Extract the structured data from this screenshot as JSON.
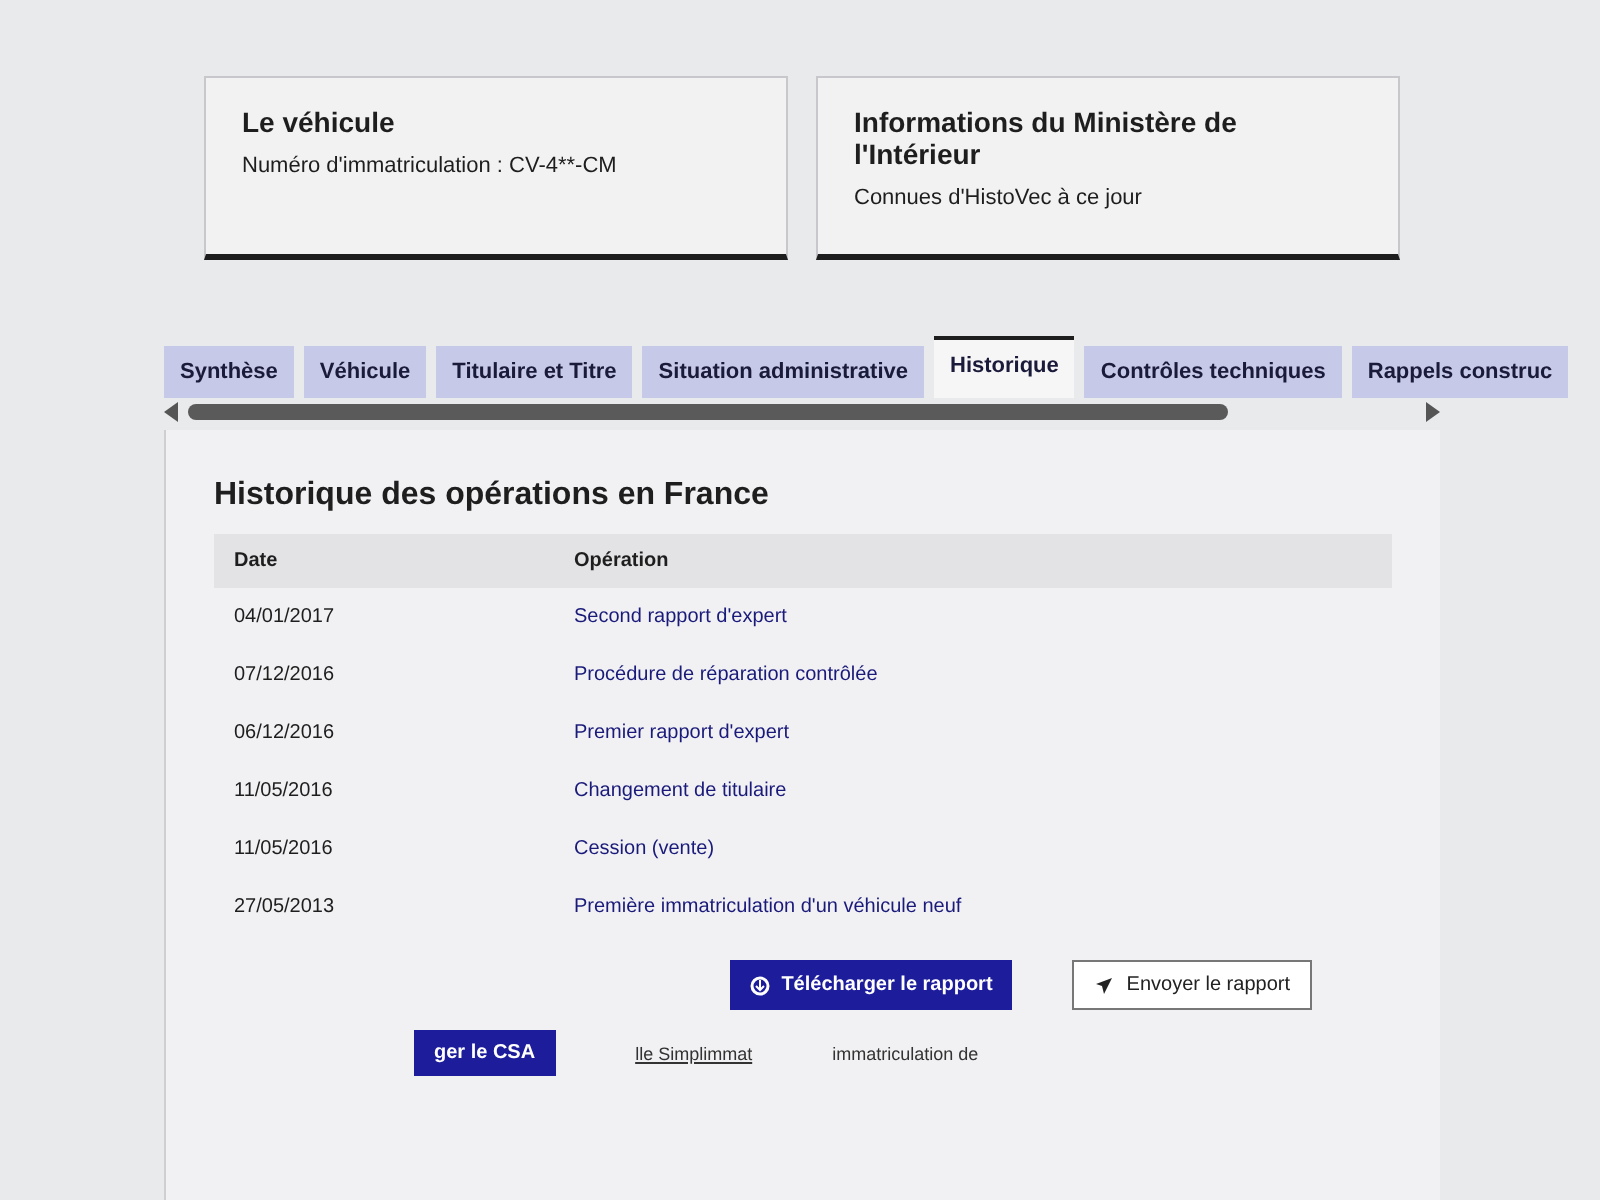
{
  "cards": [
    {
      "title": "Le véhicule",
      "subtitle": "Numéro d'immatriculation : CV-4**-CM"
    },
    {
      "title": "Informations du Ministère de l'Intérieur",
      "subtitle": "Connues d'HistoVec à ce jour"
    }
  ],
  "tabs": [
    {
      "label": "Synthèse",
      "selected": false
    },
    {
      "label": "Véhicule",
      "selected": false
    },
    {
      "label": "Titulaire et Titre",
      "selected": false
    },
    {
      "label": "Situation administrative",
      "selected": false
    },
    {
      "label": "Historique",
      "selected": true
    },
    {
      "label": "Contrôles techniques",
      "selected": false
    },
    {
      "label": "Rappels construc",
      "selected": false
    }
  ],
  "section": {
    "title": "Historique des opérations en France",
    "table": {
      "columns": [
        "Date",
        "Opération"
      ],
      "rows": [
        [
          "04/01/2017",
          "Second rapport d'expert"
        ],
        [
          "07/12/2016",
          "Procédure de réparation contrôlée"
        ],
        [
          "06/12/2016",
          "Premier rapport d'expert"
        ],
        [
          "11/05/2016",
          "Changement de titulaire"
        ],
        [
          "11/05/2016",
          "Cession (vente)"
        ],
        [
          "27/05/2013",
          "Première immatriculation d'un véhicule neuf"
        ]
      ]
    }
  },
  "actions": [
    {
      "label": "Télécharger le rapport",
      "kind": "primary"
    },
    {
      "label": "Envoyer le rapport",
      "kind": "secondary"
    }
  ],
  "footer": {
    "button": "ger le CSA",
    "link": "lle Simplimmat",
    "note": "immatriculation de"
  }
}
